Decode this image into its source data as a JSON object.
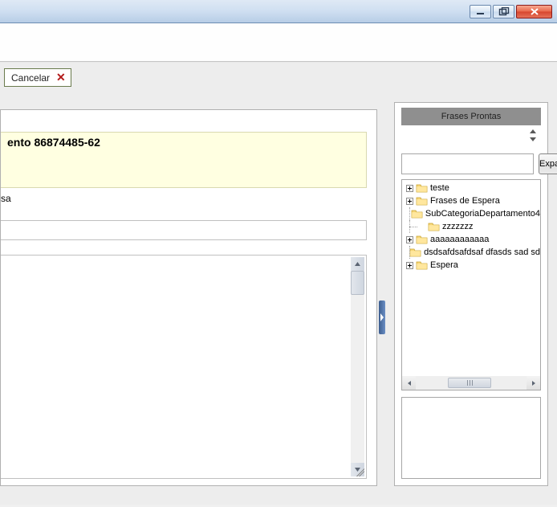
{
  "titlebar": {},
  "toolbar": {
    "cancel_label": "Cancelar"
  },
  "left": {
    "headline": "ento 86874485-62",
    "partial_label": "sa",
    "textbox_value": "",
    "textarea_value": ""
  },
  "right": {
    "panel_title": "Frases Prontas",
    "search_value": "",
    "expand_label": "Expandir",
    "tree": [
      {
        "label": "teste",
        "expandable": true,
        "indent": 0
      },
      {
        "label": "Frases de Espera",
        "expandable": true,
        "indent": 0
      },
      {
        "label": "SubCategoriaDepartamento4",
        "expandable": false,
        "indent": 1
      },
      {
        "label": "zzzzzzz",
        "expandable": false,
        "indent": 1
      },
      {
        "label": "aaaaaaaaaaaa",
        "expandable": true,
        "indent": 0
      },
      {
        "label": "dsdsafdsafdsaf dfasds sad sd",
        "expandable": false,
        "indent": 1
      },
      {
        "label": "Espera",
        "expandable": true,
        "indent": 0
      }
    ]
  }
}
